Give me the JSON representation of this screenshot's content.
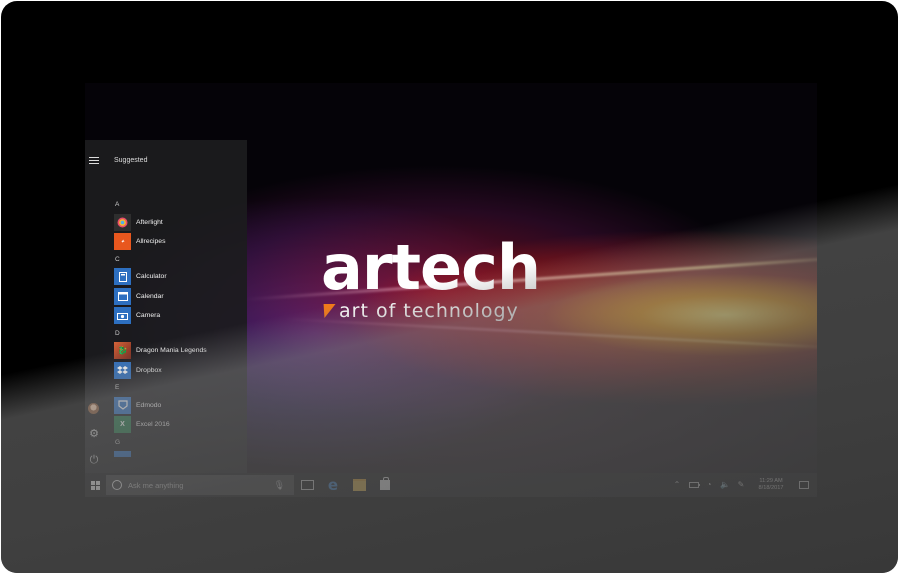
{
  "wallpaper": {
    "logo_word": "artech",
    "logo_tagline": "art of technology"
  },
  "start_menu": {
    "suggested_label": "Suggested",
    "groups": [
      {
        "letter": "A",
        "apps": [
          {
            "label": "Afterlight",
            "icon": "afterlight-icon",
            "color": "#3a3a3a"
          },
          {
            "label": "Allrecipes",
            "icon": "allrecipes-icon",
            "color": "#e8571e"
          }
        ]
      },
      {
        "letter": "C",
        "apps": [
          {
            "label": "Calculator",
            "icon": "calculator-icon",
            "color": "#2d6fc0"
          },
          {
            "label": "Calendar",
            "icon": "calendar-icon",
            "color": "#2d6fc0"
          },
          {
            "label": "Camera",
            "icon": "camera-icon",
            "color": "#2d6fc0"
          }
        ]
      },
      {
        "letter": "D",
        "apps": [
          {
            "label": "Dragon Mania Legends",
            "icon": "dragon-mania-legends-icon",
            "color": "#b8452a"
          },
          {
            "label": "Dropbox",
            "icon": "dropbox-icon",
            "color": "#2d6fc0"
          }
        ]
      },
      {
        "letter": "E",
        "apps": [
          {
            "label": "Edmodo",
            "icon": "edmodo-icon",
            "color": "#2d6fc0"
          },
          {
            "label": "Excel 2016",
            "icon": "excel-icon",
            "color": "#217346"
          }
        ]
      },
      {
        "letter": "G",
        "apps": []
      }
    ]
  },
  "taskbar": {
    "search_placeholder": "Ask me anything",
    "time": "11:29 AM",
    "date": "8/18/2017"
  }
}
